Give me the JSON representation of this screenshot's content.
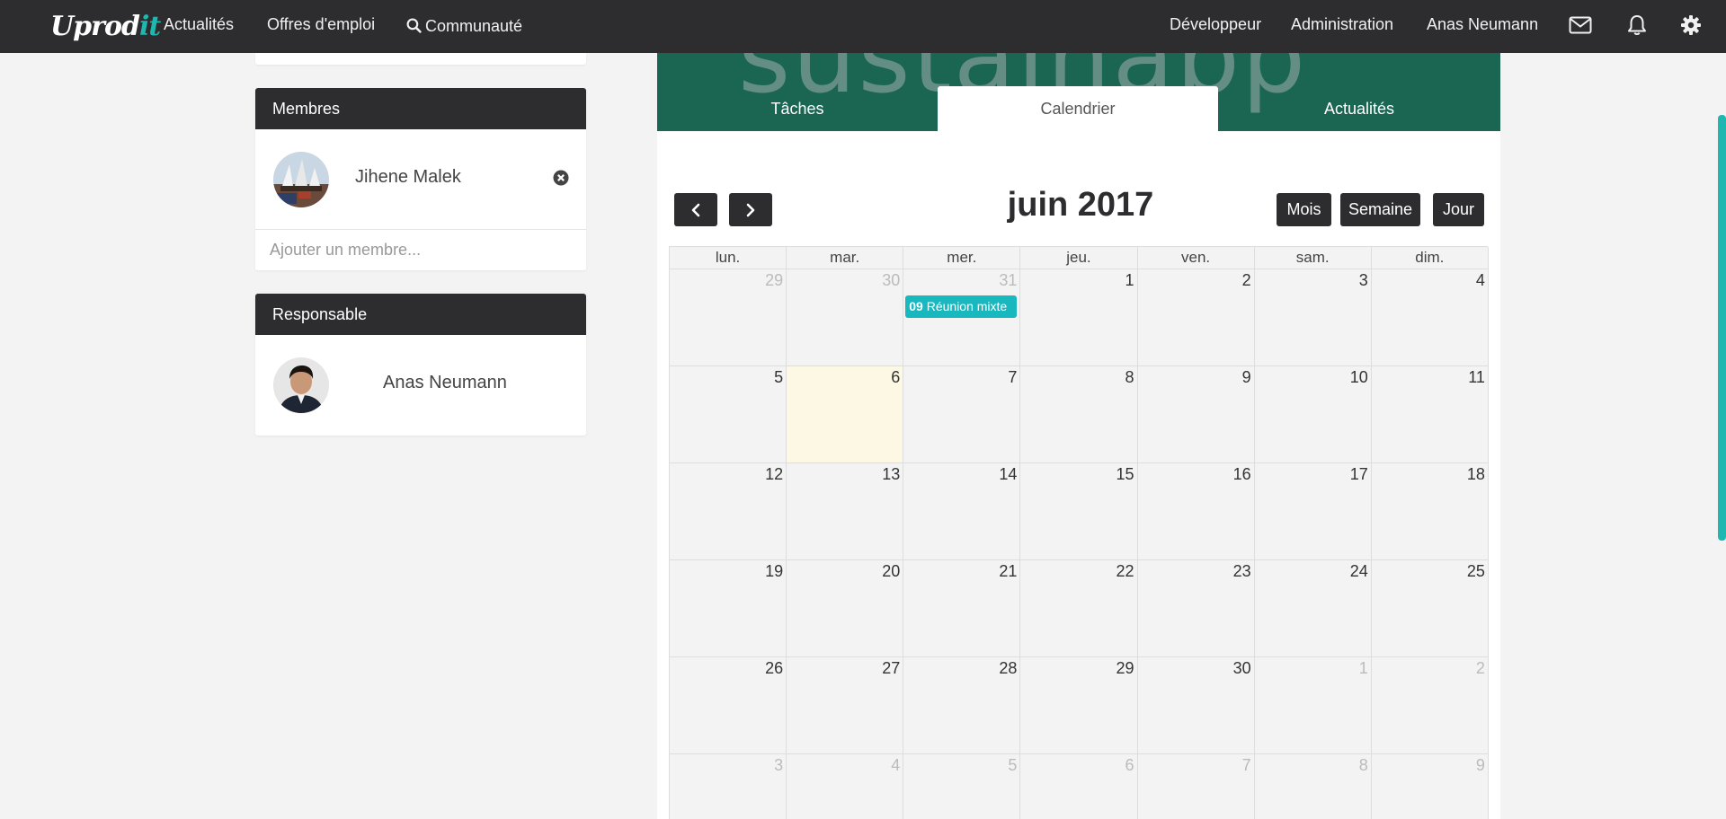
{
  "navbar": {
    "logo_main": "Uprod",
    "logo_accent": "it",
    "items": [
      "Actualités",
      "Offres d'emploi",
      "Communauté"
    ],
    "right_items": [
      "Développeur",
      "Administration",
      "Anas Neumann"
    ],
    "icons": [
      "envelope-icon",
      "bell-icon",
      "gear-icon"
    ]
  },
  "members_panel": {
    "title": "Membres",
    "member_name": "Jihene Malek",
    "add_placeholder": "Ajouter un membre..."
  },
  "responsible_panel": {
    "title": "Responsable",
    "name": "Anas Neumann"
  },
  "project": {
    "banner_text": "sustainapp",
    "tabs": [
      "Tâches",
      "Calendrier",
      "Actualités"
    ],
    "active_tab": "Calendrier"
  },
  "calendar": {
    "title": "juin 2017",
    "views": [
      "Mois",
      "Semaine",
      "Jour"
    ],
    "weekdays": [
      "lun.",
      "mar.",
      "mer.",
      "jeu.",
      "ven.",
      "sam.",
      "dim."
    ],
    "weeks": [
      [
        "29",
        "30",
        "31",
        "1",
        "2",
        "3",
        "4"
      ],
      [
        "5",
        "6",
        "7",
        "8",
        "9",
        "10",
        "11"
      ],
      [
        "12",
        "13",
        "14",
        "15",
        "16",
        "17",
        "18"
      ],
      [
        "19",
        "20",
        "21",
        "22",
        "23",
        "24",
        "25"
      ],
      [
        "26",
        "27",
        "28",
        "29",
        "30",
        "1",
        "2"
      ],
      [
        "3",
        "4",
        "5",
        "6",
        "7",
        "8",
        "9"
      ]
    ],
    "event": {
      "time": "09",
      "title": "Réunion mixte"
    }
  },
  "colors": {
    "navbar": "#2d2d2f",
    "accent": "#1fb8b0",
    "banner": "#1a6652",
    "event": "#19b8bf",
    "today": "#fcf8e3"
  }
}
